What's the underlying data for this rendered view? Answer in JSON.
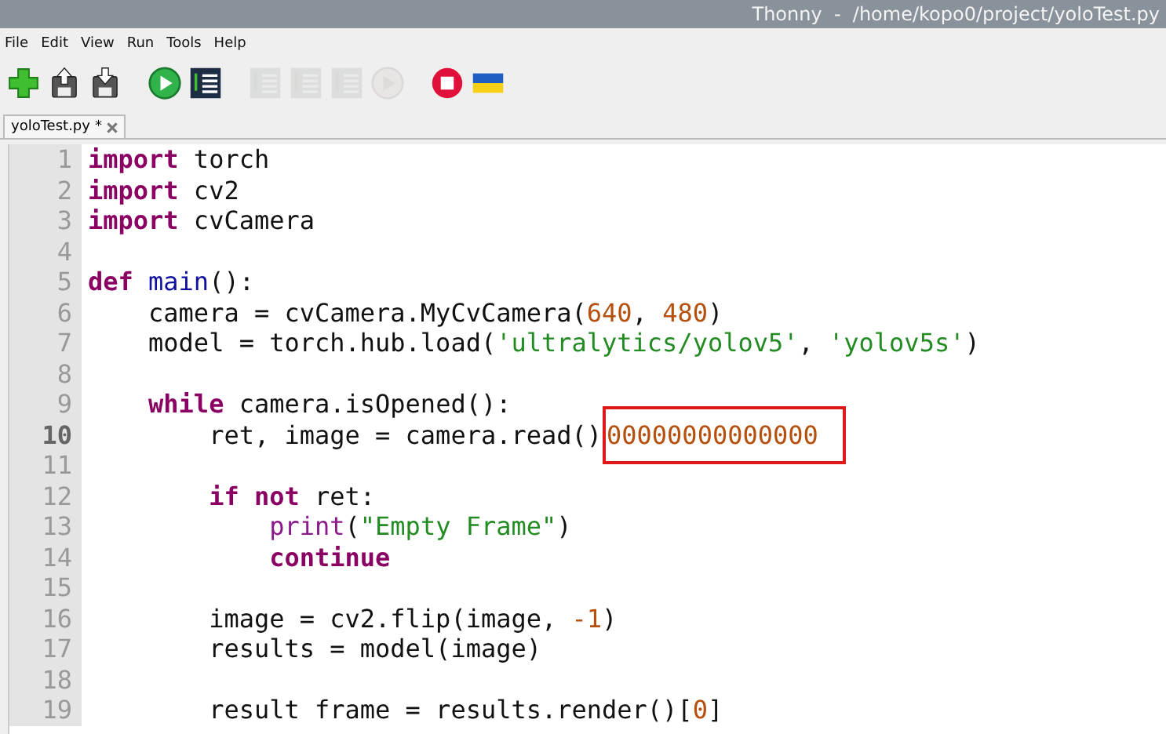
{
  "window": {
    "title": "Thonny  -  /home/kopo0/project/yoloTest.py"
  },
  "menu": [
    "File",
    "Edit",
    "View",
    "Run",
    "Tools",
    "Help"
  ],
  "toolbar": [
    {
      "kind": "new",
      "disabled": false
    },
    {
      "kind": "load",
      "disabled": false
    },
    {
      "kind": "save",
      "disabled": false
    },
    {
      "kind": "run",
      "disabled": false
    },
    {
      "kind": "debug",
      "disabled": false
    },
    {
      "kind": "step-over",
      "disabled": true
    },
    {
      "kind": "step-into",
      "disabled": true
    },
    {
      "kind": "step-out",
      "disabled": true
    },
    {
      "kind": "resume",
      "disabled": true
    },
    {
      "kind": "stop",
      "disabled": false
    },
    {
      "kind": "flag",
      "disabled": false
    }
  ],
  "tabs": [
    {
      "label": "yoloTest.py",
      "modified_mark": "*",
      "selected": true
    }
  ],
  "editor": {
    "lines": [
      {
        "number": "1",
        "current": false,
        "tokens": [
          {
            "kind": "kw",
            "text": "import"
          },
          {
            "kind": "plain",
            "text": " torch"
          }
        ]
      },
      {
        "number": "2",
        "current": false,
        "tokens": [
          {
            "kind": "kw",
            "text": "import"
          },
          {
            "kind": "plain",
            "text": " cv2"
          }
        ]
      },
      {
        "number": "3",
        "current": false,
        "tokens": [
          {
            "kind": "kw",
            "text": "import"
          },
          {
            "kind": "plain",
            "text": " cvCamera"
          }
        ]
      },
      {
        "number": "4",
        "current": false
      },
      {
        "number": "5",
        "current": false,
        "tokens": [
          {
            "kind": "kw",
            "text": "def "
          },
          {
            "kind": "def",
            "text": "main"
          },
          {
            "kind": "plain",
            "text": "():"
          }
        ]
      },
      {
        "number": "6",
        "current": false,
        "tokens": [
          {
            "kind": "plain",
            "text": "    camera = cvCamera.MyCvCamera("
          },
          {
            "kind": "num",
            "text": "640"
          },
          {
            "kind": "plain",
            "text": ", "
          },
          {
            "kind": "num",
            "text": "480"
          },
          {
            "kind": "plain",
            "text": ")"
          }
        ]
      },
      {
        "number": "7",
        "current": false,
        "tokens": [
          {
            "kind": "plain",
            "text": "    model = torch.hub.load("
          },
          {
            "kind": "str",
            "text": "'ultralytics/yolov5'"
          },
          {
            "kind": "plain",
            "text": ", "
          },
          {
            "kind": "str",
            "text": "'yolov5s'"
          },
          {
            "kind": "plain",
            "text": ")"
          }
        ]
      },
      {
        "number": "8",
        "current": false
      },
      {
        "number": "9",
        "current": false,
        "tokens": [
          {
            "kind": "kw",
            "text": "    while"
          },
          {
            "kind": "plain",
            "text": " camera.isOpened():"
          }
        ]
      },
      {
        "number": "10",
        "current": true,
        "tokens": [
          {
            "kind": "plain",
            "text": "        ret, image = camera.read()"
          },
          {
            "kind": "num",
            "text": "00000000000000",
            "boxed": true
          }
        ]
      },
      {
        "number": "11",
        "current": false
      },
      {
        "number": "12",
        "current": false,
        "tokens": [
          {
            "kind": "kw",
            "text": "        if"
          },
          {
            "kind": "kw",
            "text": " not"
          },
          {
            "kind": "plain",
            "text": " ret:"
          }
        ]
      },
      {
        "number": "13",
        "current": false,
        "tokens": [
          {
            "kind": "builtin",
            "text": "            print"
          },
          {
            "kind": "plain",
            "text": "("
          },
          {
            "kind": "str",
            "text": "\"Empty Frame\""
          },
          {
            "kind": "plain",
            "text": ")"
          }
        ]
      },
      {
        "number": "14",
        "current": false,
        "tokens": [
          {
            "kind": "kw",
            "text": "            continue"
          }
        ]
      },
      {
        "number": "15",
        "current": false
      },
      {
        "number": "16",
        "current": false,
        "tokens": [
          {
            "kind": "plain",
            "text": "        image = cv2.flip(image, "
          },
          {
            "kind": "num",
            "text": "-1"
          },
          {
            "kind": "plain",
            "text": ")"
          }
        ]
      },
      {
        "number": "17",
        "current": false,
        "tokens": [
          {
            "kind": "plain",
            "text": "        results = model(image)"
          }
        ]
      },
      {
        "number": "18",
        "current": false
      },
      {
        "number": "19",
        "current": false,
        "tokens": [
          {
            "kind": "plain",
            "text": "        result frame = results.render()["
          },
          {
            "kind": "num",
            "text": "0"
          },
          {
            "kind": "plain",
            "text": "]"
          }
        ]
      }
    ]
  }
}
